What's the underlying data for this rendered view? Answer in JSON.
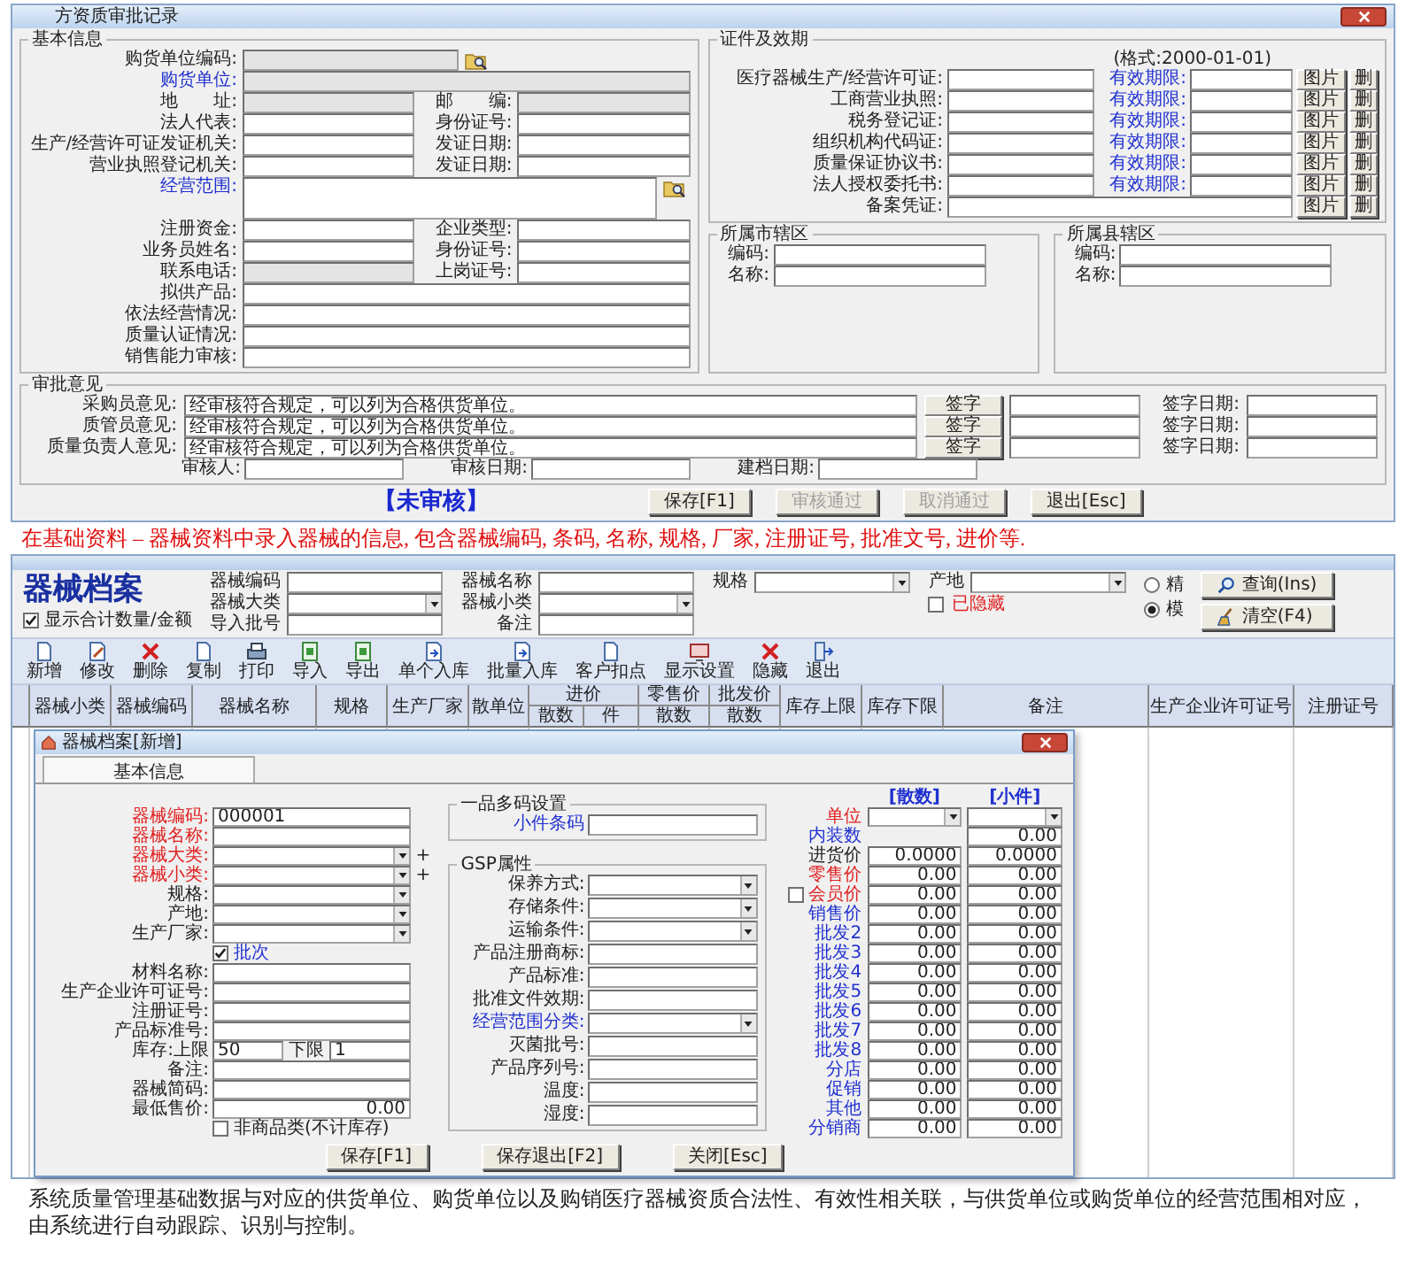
{
  "approval_window": {
    "title": "方资质审批记录",
    "basic_info": {
      "title": "基本信息",
      "rows": [
        {
          "kind": "lookup",
          "fields": [
            {
              "label": "购货单位编码:",
              "disabled": true,
              "linked": false
            }
          ]
        },
        {
          "kind": "wide",
          "fields": [
            {
              "label": "购货单位:",
              "disabled": true,
              "linked": true
            }
          ]
        },
        {
          "kind": "pair",
          "fields": [
            {
              "label": "地　　址:",
              "disabled": true,
              "linked": false
            },
            {
              "label": "邮　　编:",
              "disabled": true,
              "linked": false
            }
          ]
        },
        {
          "kind": "pair",
          "fields": [
            {
              "label": "法人代表:",
              "disabled": false,
              "linked": false
            },
            {
              "label": "身份证号:",
              "disabled": false,
              "linked": false
            }
          ]
        },
        {
          "kind": "pair",
          "fields": [
            {
              "label": "生产/经营许可证发证机关:",
              "disabled": false,
              "linked": false
            },
            {
              "label": "发证日期:",
              "disabled": false,
              "linked": false
            }
          ]
        },
        {
          "kind": "pair",
          "fields": [
            {
              "label": "营业执照登记机关:",
              "disabled": false,
              "linked": false
            },
            {
              "label": "发证日期:",
              "disabled": false,
              "linked": false
            }
          ]
        },
        {
          "kind": "area",
          "fields": [
            {
              "label": "经营范围:",
              "disabled": false,
              "linked": true
            }
          ]
        },
        {
          "kind": "pair",
          "fields": [
            {
              "label": "注册资金:",
              "disabled": false,
              "linked": false
            },
            {
              "label": "企业类型:",
              "disabled": false,
              "linked": false
            }
          ]
        },
        {
          "kind": "pair",
          "fields": [
            {
              "label": "业务员姓名:",
              "disabled": false,
              "linked": false
            },
            {
              "label": "身份证号:",
              "disabled": false,
              "linked": false
            }
          ]
        },
        {
          "kind": "pair",
          "fields": [
            {
              "label": "联系电话:",
              "disabled": true,
              "linked": false
            },
            {
              "label": "上岗证号:",
              "disabled": false,
              "linked": false
            }
          ]
        },
        {
          "kind": "wide",
          "fields": [
            {
              "label": "拟供产品:",
              "disabled": false,
              "linked": false
            }
          ]
        },
        {
          "kind": "wide",
          "fields": [
            {
              "label": "依法经营情况:",
              "disabled": false,
              "linked": false
            }
          ]
        },
        {
          "kind": "wide",
          "fields": [
            {
              "label": "质量认证情况:",
              "disabled": false,
              "linked": false
            }
          ]
        },
        {
          "kind": "wide",
          "fields": [
            {
              "label": "销售能力审核:",
              "disabled": false,
              "linked": false
            }
          ]
        }
      ]
    },
    "certificates": {
      "title": "证件及效期",
      "format_hint": "(格式:2000-01-01)",
      "rows": [
        {
          "label": "医疗器械生产/经营许可证:",
          "expiry_label": "有效期限:",
          "photo_button": "图片",
          "delete_button": "删"
        },
        {
          "label": "工商营业执照:",
          "expiry_label": "有效期限:",
          "photo_button": "图片",
          "delete_button": "删"
        },
        {
          "label": "税务登记证:",
          "expiry_label": "有效期限:",
          "photo_button": "图片",
          "delete_button": "删"
        },
        {
          "label": "组织机构代码证:",
          "expiry_label": "有效期限:",
          "photo_button": "图片",
          "delete_button": "删"
        },
        {
          "label": "质量保证协议书:",
          "expiry_label": "有效期限:",
          "photo_button": "图片",
          "delete_button": "删"
        },
        {
          "label": "法人授权委托书:",
          "expiry_label": "有效期限:",
          "photo_button": "图片",
          "delete_button": "删"
        },
        {
          "label": "备案凭证:",
          "photo_button": "图片",
          "delete_button": "删"
        }
      ]
    },
    "districts": [
      {
        "title": "所属市辖区",
        "fields": [
          "编码:",
          "名称:"
        ]
      },
      {
        "title": "所属县辖区",
        "fields": [
          "编码:",
          "名称:"
        ]
      }
    ],
    "approval": {
      "title": "审批意见",
      "opinions": [
        {
          "label": "采购员意见:",
          "value": "经审核符合规定，可以列为合格供货单位。",
          "sign_button": "签字",
          "date_label": "签字日期:"
        },
        {
          "label": "质管员意见:",
          "value": "经审核符合规定，可以列为合格供货单位。",
          "sign_button": "签字",
          "date_label": "签字日期:"
        },
        {
          "label": "质量负责人意见:",
          "value": "经审核符合规定，可以列为合格供货单位。",
          "sign_button": "签字",
          "date_label": "签字日期:"
        }
      ],
      "footer_fields": [
        "审核人:",
        "审核日期:",
        "建档日期:"
      ]
    },
    "status": "【未审核】",
    "buttons": [
      {
        "label": "保存[F1]",
        "disabled": false
      },
      {
        "label": "审核通过",
        "disabled": true
      },
      {
        "label": "取消通过",
        "disabled": true
      },
      {
        "label": "退出[Esc]",
        "disabled": false
      }
    ]
  },
  "caption_1": "在基础资料 – 器械资料中录入器械的信息, 包含器械编码, 条码, 名称, 规格, 厂家, 注册证号, 批准文号, 进价等.",
  "device_window": {
    "heading": "器械档案",
    "show_totals": {
      "label": "显示合计数量/金额",
      "checked": true
    },
    "filter_columns": [
      [
        {
          "kind": "text",
          "label": "器械编码"
        },
        {
          "kind": "select",
          "label": "器械大类"
        },
        {
          "kind": "text",
          "label": "导入批号"
        }
      ],
      [
        {
          "kind": "text",
          "label": "器械名称"
        },
        {
          "kind": "select",
          "label": "器械小类"
        },
        {
          "kind": "text",
          "label": "备注"
        }
      ],
      [
        {
          "kind": "select",
          "label": "规格"
        }
      ],
      [
        {
          "kind": "select",
          "label": "产地"
        },
        {
          "kind": "checkbox",
          "label": "已隐藏",
          "checked": false
        }
      ]
    ],
    "match_options": [
      {
        "label": "精",
        "selected": false
      },
      {
        "label": "模",
        "selected": true
      }
    ],
    "action_buttons": [
      {
        "label": "查询(Ins)",
        "kind": "search"
      },
      {
        "label": "清空(F4)",
        "kind": "clear"
      }
    ],
    "toolbar": [
      {
        "label": "新增",
        "kind": "doc"
      },
      {
        "label": "修改",
        "kind": "edit"
      },
      {
        "label": "删除",
        "kind": "delete"
      },
      {
        "label": "复制",
        "kind": "doc"
      },
      {
        "label": "打印",
        "kind": "print"
      },
      {
        "label": "导入",
        "kind": "sheet"
      },
      {
        "label": "导出",
        "kind": "sheet"
      },
      {
        "label": "单个入库",
        "kind": "inbox"
      },
      {
        "label": "批量入库",
        "kind": "inbox"
      },
      {
        "label": "客户扣点",
        "kind": "doc"
      },
      {
        "label": "显示设置",
        "kind": "screen"
      },
      {
        "label": "隐藏",
        "kind": "delete"
      },
      {
        "label": "退出",
        "kind": "exit"
      }
    ],
    "columns": [
      {
        "label": "器械小类"
      },
      {
        "label": "器械编码"
      },
      {
        "label": "器械名称"
      },
      {
        "label": "规格"
      },
      {
        "label": "生产厂家"
      },
      {
        "label": "散单位"
      },
      {
        "label": "进价",
        "sub": [
          "散数",
          "件"
        ]
      },
      {
        "label": "零售价",
        "sub": [
          "散数"
        ]
      },
      {
        "label": "批发价",
        "sub": [
          "散数"
        ]
      },
      {
        "label": "库存上限"
      },
      {
        "label": "库存下限"
      },
      {
        "label": "备注"
      },
      {
        "label": "生产企业许可证号"
      },
      {
        "label": "注册证号"
      }
    ],
    "dialog": {
      "title": "器械档案[新增]",
      "tabs": [
        {
          "label": "基本信息",
          "selected": true
        }
      ],
      "left_fields": [
        {
          "kind": "text",
          "label": "器械编码:",
          "required": true,
          "linked": false,
          "value": "000001"
        },
        {
          "kind": "text",
          "label": "器械名称:",
          "required": true,
          "linked": false
        },
        {
          "kind": "select",
          "label": "器械大类:",
          "required": true,
          "linked": false,
          "add": "+"
        },
        {
          "kind": "select",
          "label": "器械小类:",
          "required": true,
          "linked": false,
          "add": "+"
        },
        {
          "kind": "select",
          "label": "规格:",
          "required": false,
          "linked": false
        },
        {
          "kind": "select",
          "label": "产地:",
          "required": false,
          "linked": false
        },
        {
          "kind": "select",
          "label": "生产厂家:",
          "required": false,
          "linked": false
        },
        {
          "kind": "checkbox",
          "label": "批次",
          "required": false,
          "linked": true,
          "checked": true
        },
        {
          "kind": "text",
          "label": "材料名称:",
          "required": false,
          "linked": false
        },
        {
          "kind": "text",
          "label": "生产企业许可证号:",
          "required": false,
          "linked": false
        },
        {
          "kind": "text",
          "label": "注册证号:",
          "required": false,
          "linked": false
        },
        {
          "kind": "text",
          "label": "产品标准号:",
          "required": false,
          "linked": false
        },
        {
          "kind": "range",
          "label": "库存:上限",
          "required": false,
          "linked": false,
          "value": "50",
          "label2": "下限",
          "value2": "1"
        },
        {
          "kind": "text",
          "label": "备注:",
          "required": false,
          "linked": false
        },
        {
          "kind": "text",
          "label": "器械简码:",
          "required": false,
          "linked": false
        },
        {
          "kind": "number",
          "label": "最低售价:",
          "required": false,
          "linked": false,
          "value": "0.00"
        },
        {
          "kind": "checkbox",
          "label": "非商品类(不计库存)",
          "required": false,
          "linked": false,
          "checked": false
        }
      ],
      "barcode_group": {
        "title": "一品多码设置",
        "fields": [
          {
            "kind": "text",
            "label": "小件条码",
            "linked": true
          }
        ]
      },
      "gsp_group": {
        "title": "GSP属性",
        "fields": [
          {
            "kind": "select",
            "label": "保养方式:",
            "linked": false
          },
          {
            "kind": "select",
            "label": "存储条件:",
            "linked": false
          },
          {
            "kind": "select",
            "label": "运输条件:",
            "linked": false
          },
          {
            "kind": "text",
            "label": "产品注册商标:",
            "linked": false
          },
          {
            "kind": "text",
            "label": "产品标准:",
            "linked": false
          },
          {
            "kind": "text",
            "label": "批准文件效期:",
            "linked": false
          },
          {
            "kind": "select",
            "label": "经营范围分类:",
            "linked": true
          },
          {
            "kind": "text",
            "label": "灭菌批号:",
            "linked": false
          },
          {
            "kind": "text",
            "label": "产品序列号:",
            "linked": false
          },
          {
            "kind": "text",
            "label": "温度:",
            "linked": false
          },
          {
            "kind": "text",
            "label": "湿度:",
            "linked": false
          }
        ]
      },
      "price_headers": [
        "[散数]",
        "[小件]"
      ],
      "price_rows": [
        {
          "kind": "select",
          "label": "单位",
          "required": true,
          "linked": false
        },
        {
          "kind": "single",
          "label": "内装数",
          "required": false,
          "linked": true,
          "values": [
            "0.00"
          ]
        },
        {
          "kind": "pair",
          "label": "进货价",
          "required": false,
          "linked": false,
          "values": [
            "0.0000",
            "0.0000"
          ]
        },
        {
          "kind": "pair",
          "label": "零售价",
          "required": true,
          "linked": false,
          "values": [
            "0.00",
            "0.00"
          ]
        },
        {
          "kind": "check",
          "label": "会员价",
          "required": true,
          "linked": false,
          "checked": false,
          "values": [
            "0.00",
            "0.00"
          ]
        },
        {
          "kind": "pair",
          "label": "销售价",
          "required": false,
          "linked": true,
          "values": [
            "0.00",
            "0.00"
          ]
        },
        {
          "kind": "pair",
          "label": "批发2",
          "required": false,
          "linked": true,
          "values": [
            "0.00",
            "0.00"
          ]
        },
        {
          "kind": "pair",
          "label": "批发3",
          "required": false,
          "linked": true,
          "values": [
            "0.00",
            "0.00"
          ]
        },
        {
          "kind": "pair",
          "label": "批发4",
          "required": false,
          "linked": true,
          "values": [
            "0.00",
            "0.00"
          ]
        },
        {
          "kind": "pair",
          "label": "批发5",
          "required": false,
          "linked": true,
          "values": [
            "0.00",
            "0.00"
          ]
        },
        {
          "kind": "pair",
          "label": "批发6",
          "required": false,
          "linked": true,
          "values": [
            "0.00",
            "0.00"
          ]
        },
        {
          "kind": "pair",
          "label": "批发7",
          "required": false,
          "linked": true,
          "values": [
            "0.00",
            "0.00"
          ]
        },
        {
          "kind": "pair",
          "label": "批发8",
          "required": false,
          "linked": true,
          "values": [
            "0.00",
            "0.00"
          ]
        },
        {
          "kind": "pair",
          "label": "分店",
          "required": false,
          "linked": true,
          "values": [
            "0.00",
            "0.00"
          ]
        },
        {
          "kind": "pair",
          "label": "促销",
          "required": false,
          "linked": true,
          "values": [
            "0.00",
            "0.00"
          ]
        },
        {
          "kind": "pair",
          "label": "其他",
          "required": false,
          "linked": true,
          "values": [
            "0.00",
            "0.00"
          ]
        },
        {
          "kind": "pair",
          "label": "分销商",
          "required": false,
          "linked": true,
          "values": [
            "0.00",
            "0.00"
          ]
        }
      ],
      "buttons": [
        "保存[F1]",
        "保存退出[F2]",
        "关闭[Esc]"
      ]
    }
  },
  "caption_2": "系统质量管理基础数据与对应的供货单位、购货单位以及购销医疗器械资质合法性、有效性相关联，与供货单位或购货单位的经营范围相对应，由系统进行自动跟踪、识别与控制。"
}
